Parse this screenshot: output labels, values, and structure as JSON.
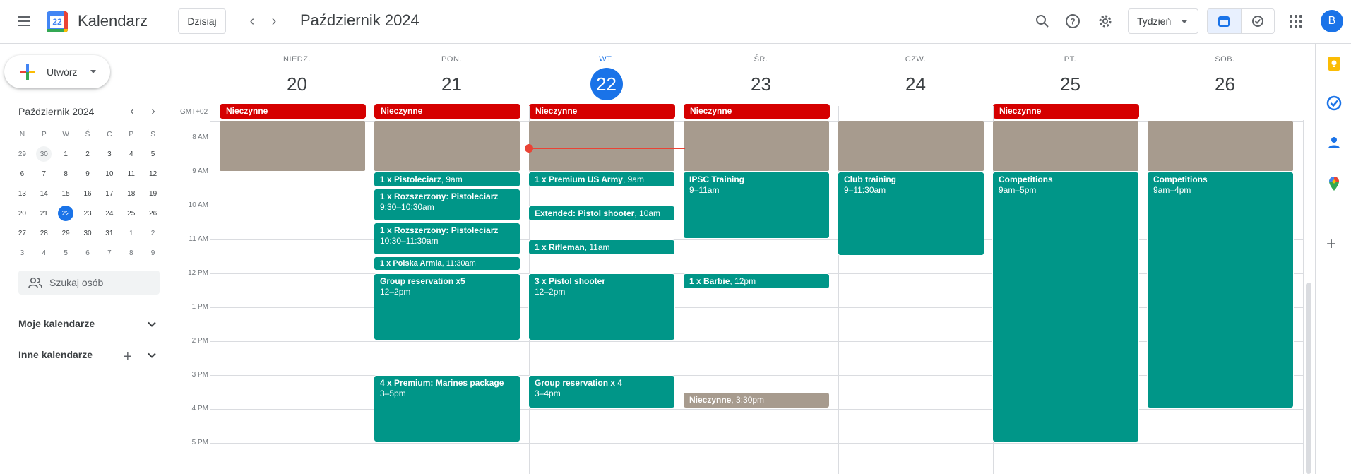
{
  "app": {
    "title": "Kalendarz",
    "logo_day": "22"
  },
  "header": {
    "today_label": "Dzisiaj",
    "period_title": "Październik 2024",
    "view_label": "Tydzień",
    "avatar_letter": "B"
  },
  "sidebar": {
    "create_label": "Utwórz",
    "mini": {
      "title": "Październik 2024",
      "dow": [
        "N",
        "P",
        "W",
        "Ś",
        "C",
        "P",
        "S"
      ],
      "weeks": [
        [
          "29",
          "30",
          "1",
          "2",
          "3",
          "4",
          "5"
        ],
        [
          "6",
          "7",
          "8",
          "9",
          "10",
          "11",
          "12"
        ],
        [
          "13",
          "14",
          "15",
          "16",
          "17",
          "18",
          "19"
        ],
        [
          "20",
          "21",
          "22",
          "23",
          "24",
          "25",
          "26"
        ],
        [
          "27",
          "28",
          "29",
          "30",
          "31",
          "1",
          "2"
        ],
        [
          "3",
          "4",
          "5",
          "6",
          "7",
          "8",
          "9"
        ]
      ]
    },
    "search_people": "Szukaj osób",
    "my_calendars": "Moje kalendarze",
    "other_calendars": "Inne kalendarze"
  },
  "week": {
    "timezone": "GMT+02",
    "days": [
      {
        "dow": "NIEDZ.",
        "num": "20"
      },
      {
        "dow": "PON.",
        "num": "21"
      },
      {
        "dow": "WT.",
        "num": "22"
      },
      {
        "dow": "ŚR.",
        "num": "23"
      },
      {
        "dow": "CZW.",
        "num": "24"
      },
      {
        "dow": "PT.",
        "num": "25"
      },
      {
        "dow": "SOB.",
        "num": "26"
      }
    ],
    "hours": [
      "8 AM",
      "9 AM",
      "10 AM",
      "11 AM",
      "12 PM",
      "1 PM",
      "2 PM",
      "3 PM",
      "4 PM",
      "5 PM"
    ],
    "allday_label": "Nieczynne",
    "events": {
      "mon": [
        {
          "title": "1 x Pistoleciarz",
          "time": ", 9am"
        },
        {
          "title": "1 x Rozszerzony: Pistoleciarz",
          "time": "9:30–10:30am"
        },
        {
          "title": "1 x Rozszerzony: Pistoleciarz",
          "time": "10:30–11:30am"
        },
        {
          "title": "1 x Polska Armia",
          "time": ", 11:30am"
        },
        {
          "title": "Group reservation x5",
          "time": "12–2pm"
        },
        {
          "title": "4 x Premium: Marines package",
          "time": "3–5pm"
        }
      ],
      "tue": [
        {
          "title": "1 x Premium US Army",
          "time": ", 9am"
        },
        {
          "title": "Extended: Pistol shooter",
          "time": ", 10am"
        },
        {
          "title": "1 x Rifleman",
          "time": ", 11am"
        },
        {
          "title": "3 x Pistol shooter",
          "time": "12–2pm"
        },
        {
          "title": "Group reservation x 4",
          "time": "3–4pm"
        }
      ],
      "wed": [
        {
          "title": "IPSC Training",
          "time": "9–11am"
        },
        {
          "title": "1 x Barbie",
          "time": ", 12pm"
        },
        {
          "title": "Nieczynne",
          "time": ", 3:30pm"
        }
      ],
      "thu": [
        {
          "title": "Club training",
          "time": "9–11:30am"
        }
      ],
      "fri": [
        {
          "title": "Competitions",
          "time": "9am–5pm"
        }
      ],
      "sat": [
        {
          "title": "Competitions",
          "time": "9am–4pm"
        }
      ]
    }
  },
  "colors": {
    "accent": "#1a73e8",
    "event": "#009688",
    "closed": "#d50000",
    "busy": "#a79b8e",
    "now": "#ea4335"
  }
}
